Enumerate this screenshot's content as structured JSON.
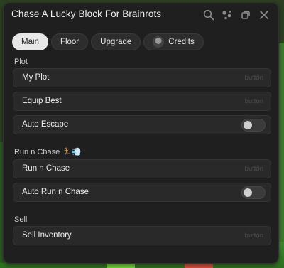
{
  "window": {
    "title": "Chase A Lucky Block For Brainrots",
    "icons": [
      "search-icon",
      "palette-icon",
      "restore-icon",
      "close-icon"
    ]
  },
  "tabs": [
    {
      "label": "Main",
      "active": true
    },
    {
      "label": "Floor",
      "active": false
    },
    {
      "label": "Upgrade",
      "active": false
    },
    {
      "label": "Credits",
      "active": false,
      "icon": "avatar-icon"
    }
  ],
  "sections": {
    "plot": {
      "label": "Plot",
      "my_plot": {
        "label": "My Plot",
        "hint": "button"
      },
      "equip_best": {
        "label": "Equip Best",
        "hint": "button"
      },
      "auto_escape": {
        "label": "Auto Escape",
        "on": false
      }
    },
    "chase": {
      "label": "Run n Chase",
      "label_emoji": "🏃💨",
      "run_chase": {
        "label": "Run n Chase",
        "hint": "button"
      },
      "auto_run_chase": {
        "label": "Auto Run n Chase",
        "on": false
      }
    },
    "sell": {
      "label": "Sell",
      "sell_inventory": {
        "label": "Sell Inventory",
        "hint": "button"
      }
    }
  },
  "colors": {
    "panel": "#1f1f1f",
    "row": "#292929",
    "active_tab": "#e7e7e7"
  }
}
